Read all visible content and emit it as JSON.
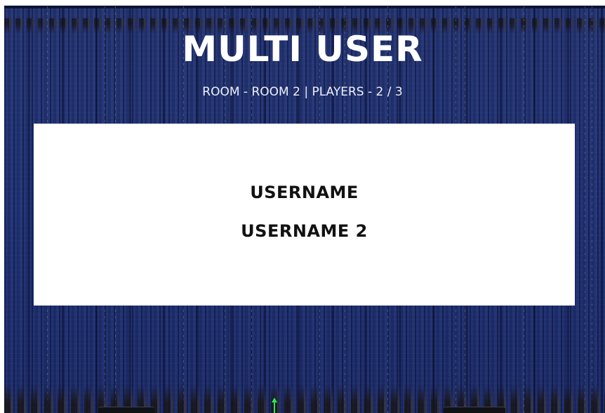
{
  "screen": {
    "title": "MULTI USER",
    "room_info": "ROOM - ROOM 2 | PLAYERS - 2 / 3"
  },
  "players_panel": {
    "players": [
      {
        "name": "USERNAME"
      },
      {
        "name": "USERNAME 2"
      }
    ]
  },
  "colors": {
    "background": "#223373",
    "panel": "#ffffff",
    "title_text": "#ffffff",
    "player_text": "#111111",
    "marker": "#2ee84a"
  },
  "icons": {
    "cursor_marker": "up-arrow-icon"
  }
}
